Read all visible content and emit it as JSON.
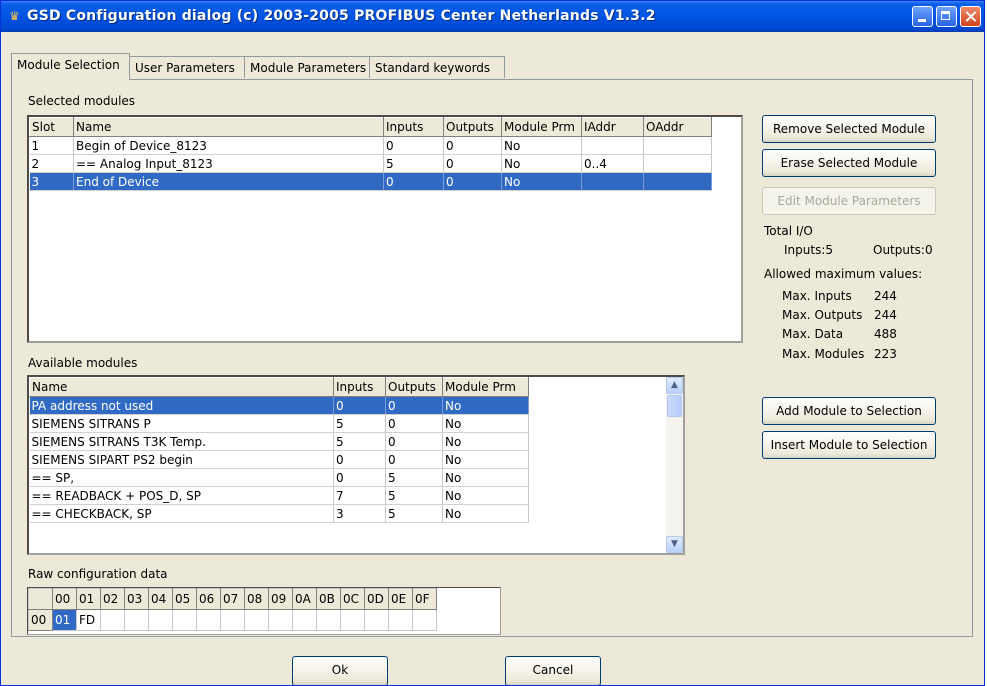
{
  "window": {
    "title": "GSD Configuration dialog (c) 2003-2005 PROFIBUS Center Netherlands V1.3.2"
  },
  "tabs": [
    {
      "label": "Module Selection",
      "active": true
    },
    {
      "label": "User Parameters",
      "active": false
    },
    {
      "label": "Module Parameters",
      "active": false
    },
    {
      "label": "Standard keywords",
      "active": false
    }
  ],
  "selected_modules": {
    "label": "Selected modules",
    "columns": [
      "Slot",
      "Name",
      "Inputs",
      "Outputs",
      "Module Prm",
      "IAddr",
      "OAddr"
    ],
    "rows": [
      {
        "slot": "1",
        "name": "Begin of Device_8123",
        "inputs": "0",
        "outputs": "0",
        "prm": "No",
        "iaddr": "",
        "oaddr": ""
      },
      {
        "slot": "2",
        "name": "== Analog Input_8123",
        "inputs": "5",
        "outputs": "0",
        "prm": "No",
        "iaddr": "0..4",
        "oaddr": ""
      },
      {
        "slot": "3",
        "name": "End of Device",
        "inputs": "0",
        "outputs": "0",
        "prm": "No",
        "iaddr": "",
        "oaddr": ""
      }
    ],
    "selected_row_index": 2
  },
  "buttons": {
    "remove": "Remove Selected Module",
    "erase": "Erase Selected Module",
    "edit": "Edit Module Parameters",
    "add": "Add Module to Selection",
    "insert": "Insert Module to Selection",
    "ok": "Ok",
    "cancel": "Cancel"
  },
  "total_io": {
    "label": "Total I/O",
    "inputs": "Inputs:5",
    "outputs": "Outputs:0",
    "allowed_label": "Allowed maximum values:",
    "max_inputs_label": "Max. Inputs",
    "max_inputs": "244",
    "max_outputs_label": "Max. Outputs",
    "max_outputs": "244",
    "max_data_label": "Max. Data",
    "max_data": "488",
    "max_modules_label": "Max. Modules",
    "max_modules": "223"
  },
  "available_modules": {
    "label": "Available modules",
    "columns": [
      "Name",
      "Inputs",
      "Outputs",
      "Module Prm"
    ],
    "rows": [
      {
        "name": "PA address not used",
        "inputs": "0",
        "outputs": "0",
        "prm": "No"
      },
      {
        "name": "SIEMENS SITRANS P",
        "inputs": "5",
        "outputs": "0",
        "prm": "No"
      },
      {
        "name": "SIEMENS SITRANS T3K Temp.",
        "inputs": "5",
        "outputs": "0",
        "prm": "No"
      },
      {
        "name": "SIEMENS SIPART PS2 begin",
        "inputs": "0",
        "outputs": "0",
        "prm": "No"
      },
      {
        "name": "== SP,",
        "inputs": "0",
        "outputs": "5",
        "prm": "No"
      },
      {
        "name": "== READBACK + POS_D, SP",
        "inputs": "7",
        "outputs": "5",
        "prm": "No"
      },
      {
        "name": "== CHECKBACK, SP",
        "inputs": "3",
        "outputs": "5",
        "prm": "No"
      }
    ],
    "selected_row_index": 0
  },
  "raw_config": {
    "label": "Raw configuration data",
    "col_headers": [
      "00",
      "01",
      "02",
      "03",
      "04",
      "05",
      "06",
      "07",
      "08",
      "09",
      "0A",
      "0B",
      "0C",
      "0D",
      "0E",
      "0F"
    ],
    "row_header": "00",
    "row_values": [
      "01",
      "FD",
      "",
      "",
      "",
      "",
      "",
      "",
      "",
      "",
      "",
      "",
      "",
      "",
      "",
      ""
    ]
  },
  "colors": {
    "selection": "#316ac5",
    "titlebar": "#0054e3",
    "dialog_bg": "#ece9d8"
  }
}
